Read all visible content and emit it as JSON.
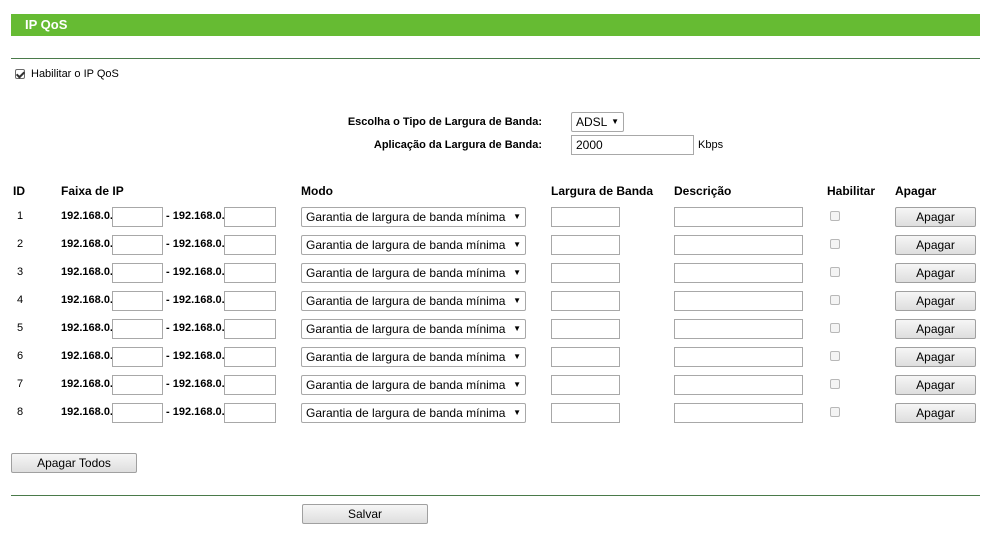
{
  "title": "IP QoS",
  "enable_qos": {
    "label": "Habilitar o IP QoS",
    "checked": true
  },
  "bandwidth_type": {
    "label": "Escolha o Tipo de Largura de Banda:",
    "value": "ADSL"
  },
  "bandwidth_app": {
    "label": "Aplicação da Largura de Banda:",
    "value": "2000",
    "unit": "Kbps"
  },
  "headers": {
    "id": "ID",
    "ip_range": "Faixa de IP",
    "mode": "Modo",
    "bandwidth": "Largura de Banda",
    "description": "Descrição",
    "enable": "Habilitar",
    "delete": "Apagar"
  },
  "rows": [
    {
      "id": "1",
      "ip_start_prefix": "192.168.0.",
      "ip_end_prefix": "- 192.168.0.",
      "mode": "Garantia de largura de banda mínima",
      "delete_label": "Apagar"
    },
    {
      "id": "2",
      "ip_start_prefix": "192.168.0.",
      "ip_end_prefix": "- 192.168.0.",
      "mode": "Garantia de largura de banda mínima",
      "delete_label": "Apagar"
    },
    {
      "id": "3",
      "ip_start_prefix": "192.168.0.",
      "ip_end_prefix": "- 192.168.0.",
      "mode": "Garantia de largura de banda mínima",
      "delete_label": "Apagar"
    },
    {
      "id": "4",
      "ip_start_prefix": "192.168.0.",
      "ip_end_prefix": "- 192.168.0.",
      "mode": "Garantia de largura de banda mínima",
      "delete_label": "Apagar"
    },
    {
      "id": "5",
      "ip_start_prefix": "192.168.0.",
      "ip_end_prefix": "- 192.168.0.",
      "mode": "Garantia de largura de banda mínima",
      "delete_label": "Apagar"
    },
    {
      "id": "6",
      "ip_start_prefix": "192.168.0.",
      "ip_end_prefix": "- 192.168.0.",
      "mode": "Garantia de largura de banda mínima",
      "delete_label": "Apagar"
    },
    {
      "id": "7",
      "ip_start_prefix": "192.168.0.",
      "ip_end_prefix": "- 192.168.0.",
      "mode": "Garantia de largura de banda mínima",
      "delete_label": "Apagar"
    },
    {
      "id": "8",
      "ip_start_prefix": "192.168.0.",
      "ip_end_prefix": "- 192.168.0.",
      "mode": "Garantia de largura de banda mínima",
      "delete_label": "Apagar"
    }
  ],
  "delete_all_label": "Apagar Todos",
  "save_label": "Salvar",
  "colors": {
    "title_bar": "#66bb33",
    "divider": "#4a7a4a"
  }
}
